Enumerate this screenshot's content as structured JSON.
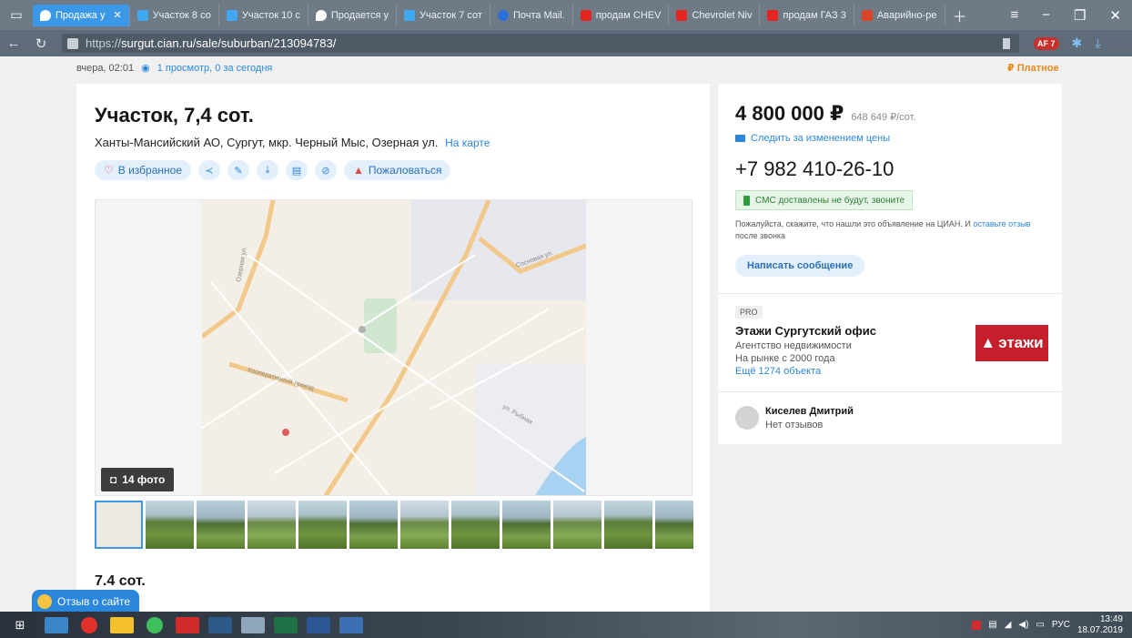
{
  "browser": {
    "tabs": [
      {
        "label": "Продажа у",
        "color": "#ffffff",
        "active": true
      },
      {
        "label": "Участок 8 со",
        "color": "#3fa8ef"
      },
      {
        "label": "Участок 10 с",
        "color": "#3fa8ef"
      },
      {
        "label": "Продается у",
        "color": "#3fa8ef"
      },
      {
        "label": "Участок 7 сот",
        "color": "#3fa8ef"
      },
      {
        "label": "Почта Mail.",
        "color": "#2b6fd8"
      },
      {
        "label": "продам CHEV",
        "color": "#e52620"
      },
      {
        "label": "Chevrolet Niv",
        "color": "#e52620"
      },
      {
        "label": "продам ГАЗ 3",
        "color": "#e52620"
      },
      {
        "label": "Аварийно-ре",
        "color": "#d94426"
      }
    ],
    "url_protocol": "https://",
    "url_rest": "surgut.cian.ru/sale/suburban/213094783/",
    "adblock_badge": "AF 7"
  },
  "listing": {
    "posted": "вчера, 02:01",
    "views": "1 просмотр, 0 за сегодня",
    "paid": "₽ Платное",
    "title": "Участок, 7,4 сот.",
    "address": "Ханты-Мансийский АО, Сургут, мкр. Черный Мыс, Озерная ул.",
    "map_link": "На карте",
    "favorite": "В избранное",
    "complain": "Пожаловаться",
    "photo_count": "14 фото",
    "area": "7.4 сот."
  },
  "sidebar": {
    "price": "4 800 000 ₽",
    "price_per": "648 649 ₽/сот.",
    "follow_price": "Следить за изменением цены",
    "phone": "+7 982 410-26-10",
    "sms_note": "СМС доставлены не будут, звоните",
    "note_text": "Пожалуйста, скажите, что нашли это объявление на ЦИАН. И",
    "note_link": "оставьте отзыв",
    "note_tail": "после звонка",
    "write_button": "Написать сообщение",
    "pro_badge": "PRO",
    "agency_name": "Этажи Сургутский офис",
    "agency_type": "Агентство недвижимости",
    "agency_years": "На рынке с 2000 года",
    "agency_more": "Ещё 1274 объекта",
    "logo_text": "этажи",
    "agent_name": "Киселев Дмитрий",
    "agent_reviews": "Нет отзывов"
  },
  "feedback_button": "Отзыв о сайте",
  "map_labels": [
    "Озерная ул.",
    "Сосновая ул.",
    "Кооперативный проезд",
    "ул. Рыбная"
  ],
  "taskbar": {
    "language": "РУС",
    "time": "13:49",
    "date": "18.07.2019"
  }
}
